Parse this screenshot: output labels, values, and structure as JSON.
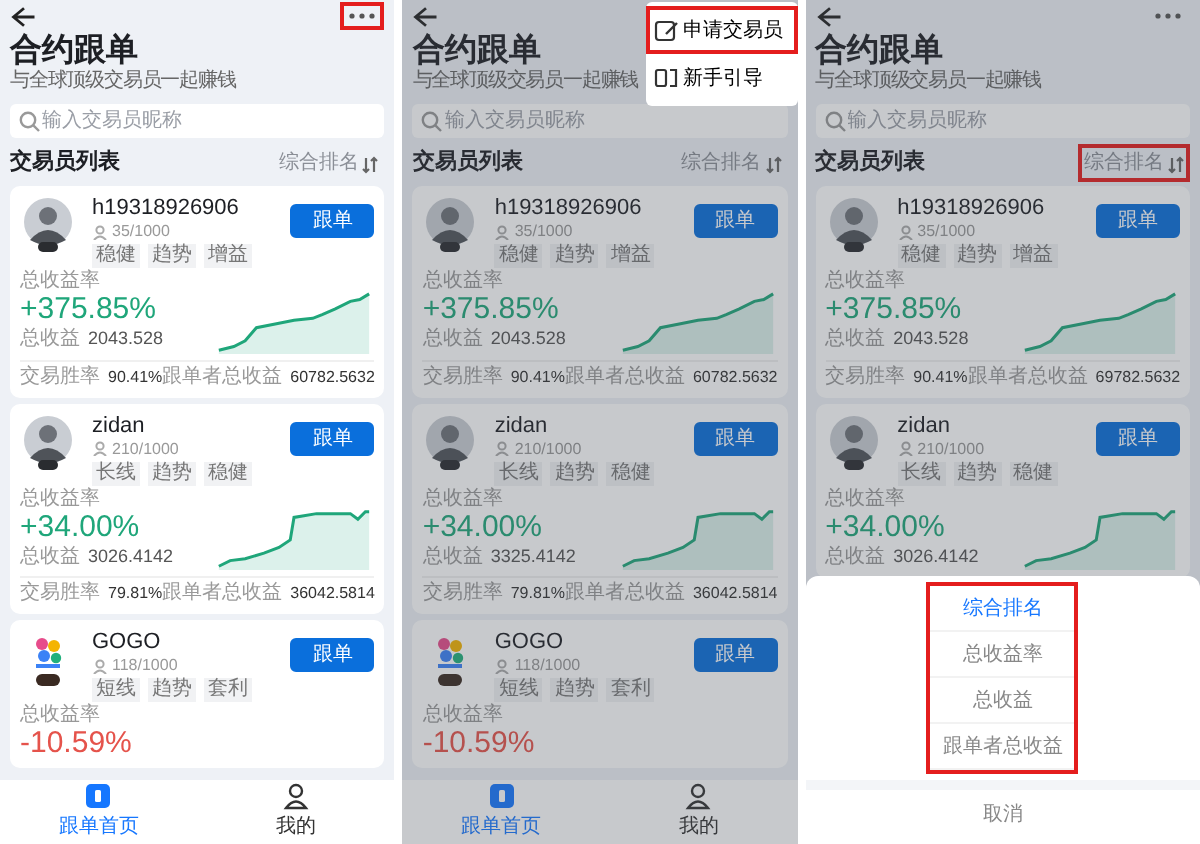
{
  "panels": [
    {
      "more_button": {
        "highlighted": true
      },
      "title": "合约跟单",
      "subtitle": "与全球顶级交易员一起赚钱",
      "search": {
        "placeholder": "输入交易员昵称"
      },
      "list_title": "交易员列表",
      "sort": {
        "label": "综合排名",
        "highlighted": false
      },
      "traders": [
        {
          "kind": "person",
          "name": "h19318926906",
          "followers": "35/1000",
          "tags": [
            "稳健",
            "趋势",
            "增益"
          ],
          "button": "跟单",
          "rate_label": "总收益率",
          "rate": "+375.85%",
          "color": "#1fa67a",
          "profit_label": "总收益",
          "profit": "2043.528",
          "win_label": "交易胜率",
          "win_rate": "90.41%",
          "follower_label": "跟单者总收益",
          "follower_profit": "60782.5632"
        },
        {
          "kind": "person",
          "name": "zidan",
          "followers": "210/1000",
          "tags": [
            "长线",
            "趋势",
            "稳健"
          ],
          "button": "跟单",
          "rate_label": "总收益率",
          "rate": "+34.00%",
          "color": "#1fa67a",
          "profit_label": "总收益",
          "profit": "3026.4142",
          "win_label": "交易胜率",
          "win_rate": "79.81%",
          "follower_label": "跟单者总收益",
          "follower_profit": "36042.5814"
        },
        {
          "kind": "logo",
          "name": "GOGO",
          "followers": "118/1000",
          "tags": [
            "短线",
            "趋势",
            "套利"
          ],
          "button": "跟单",
          "rate_label": "总收益率",
          "rate": "-10.59%",
          "color": "#e5534b"
        }
      ],
      "nav": [
        {
          "label": "跟单首页",
          "selected": true
        },
        {
          "label": "我的",
          "selected": false
        }
      ]
    },
    {
      "title": "合约跟单",
      "subtitle": "与全球顶级交易员一起赚钱",
      "search": {
        "placeholder": "输入交易员昵称"
      },
      "list_title": "交易员列表",
      "sort": {
        "label": "综合排名",
        "highlighted": false
      },
      "dimmed": true,
      "traders": [
        {
          "kind": "person",
          "name": "h19318926906",
          "followers": "35/1000",
          "tags": [
            "稳健",
            "趋势",
            "增益"
          ],
          "button": "跟单",
          "rate_label": "总收益率",
          "rate": "+375.85%",
          "color": "#2b8b6f",
          "profit_label": "总收益",
          "profit": "2043.528",
          "win_label": "交易胜率",
          "win_rate": "90.41%",
          "follower_label": "跟单者总收益",
          "follower_profit": "60782.5632"
        },
        {
          "kind": "person",
          "name": "zidan",
          "followers": "210/1000",
          "tags": [
            "长线",
            "趋势",
            "稳健"
          ],
          "button": "跟单",
          "rate_label": "总收益率",
          "rate": "+34.00%",
          "color": "#2b8b6f",
          "profit_label": "总收益",
          "profit": "3325.4142",
          "win_label": "交易胜率",
          "win_rate": "79.81%",
          "follower_label": "跟单者总收益",
          "follower_profit": "36042.5814"
        },
        {
          "kind": "logo",
          "name": "GOGO",
          "followers": "118/1000",
          "tags": [
            "短线",
            "趋势",
            "套利"
          ],
          "button": "跟单",
          "rate_label": "总收益率",
          "rate": "-10.59%",
          "color": "#b5514e"
        }
      ],
      "nav": [
        {
          "label": "跟单首页",
          "selected": true
        },
        {
          "label": "我的",
          "selected": false
        }
      ],
      "menu": [
        {
          "label": "申请交易员",
          "highlighted": true
        },
        {
          "label": "新手引导",
          "highlighted": false
        }
      ]
    },
    {
      "more_button": {
        "highlighted": false
      },
      "title": "合约跟单",
      "subtitle": "与全球顶级交易员一起赚钱",
      "search": {
        "placeholder": "输入交易员昵称"
      },
      "list_title": "交易员列表",
      "sort": {
        "label": "综合排名",
        "highlighted": true
      },
      "dimmed": true,
      "traders": [
        {
          "kind": "person",
          "name": "h19318926906",
          "followers": "35/1000",
          "tags": [
            "稳健",
            "趋势",
            "增益"
          ],
          "button": "跟单",
          "rate_label": "总收益率",
          "rate": "+375.85%",
          "color": "#2b8b6f",
          "profit_label": "总收益",
          "profit": "2043.528",
          "win_label": "交易胜率",
          "win_rate": "90.41%",
          "follower_label": "跟单者总收益",
          "follower_profit": "69782.5632"
        },
        {
          "kind": "person",
          "name": "zidan",
          "followers": "210/1000",
          "tags": [
            "长线",
            "趋势",
            "稳健"
          ],
          "button": "跟单",
          "rate_label": "总收益率",
          "rate": "+34.00%",
          "color": "#2b8b6f",
          "profit_label": "总收益",
          "profit": "3026.4142"
        }
      ],
      "sort_sheet": {
        "highlighted": true,
        "options": [
          {
            "label": "综合排名",
            "selected": true
          },
          {
            "label": "总收益率",
            "selected": false
          },
          {
            "label": "总收益",
            "selected": false
          },
          {
            "label": "跟单者总收益",
            "selected": false
          }
        ],
        "cancel": "取消"
      }
    }
  ]
}
